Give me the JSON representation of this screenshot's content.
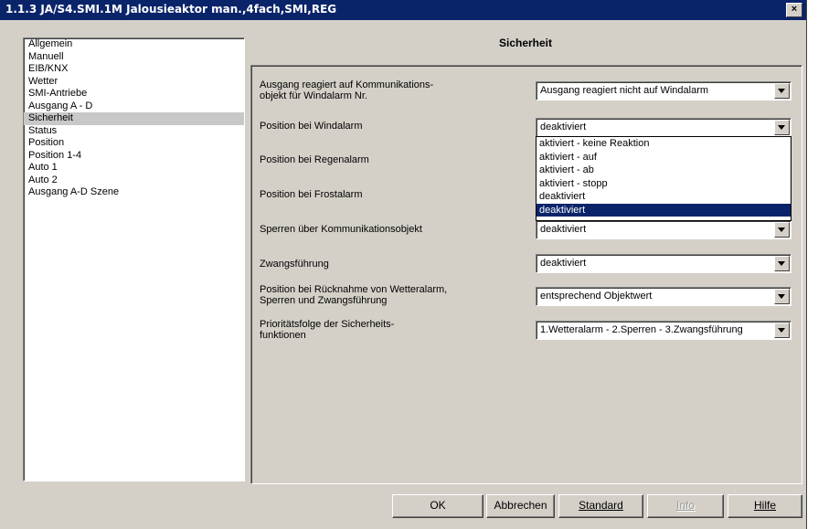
{
  "window": {
    "title": "1.1.3 JA/S4.SMI.1M Jalousieaktor man.,4fach,SMI,REG",
    "close_label": "×"
  },
  "sidebar": {
    "items": [
      {
        "label": "Allgemein"
      },
      {
        "label": "Manuell"
      },
      {
        "label": "EIB/KNX"
      },
      {
        "label": "Wetter"
      },
      {
        "label": "SMI-Antriebe"
      },
      {
        "label": "Ausgang A - D"
      },
      {
        "label": "Sicherheit",
        "selected": true
      },
      {
        "label": "Status"
      },
      {
        "label": "Position"
      },
      {
        "label": "Position 1-4"
      },
      {
        "label": "Auto 1"
      },
      {
        "label": "Auto 2"
      },
      {
        "label": "Ausgang A-D Szene"
      }
    ]
  },
  "section_title": "Sicherheit",
  "params": [
    {
      "label_lines": [
        "Ausgang reagiert auf Kommunikations-",
        "objekt für Windalarm Nr."
      ],
      "value": "Ausgang reagiert nicht auf Windalarm"
    },
    {
      "label_lines": [
        "Position bei Windalarm"
      ],
      "value": "deaktiviert"
    },
    {
      "label_lines": [
        "Position bei Regenalarm"
      ]
    },
    {
      "label_lines": [
        "Position bei Frostalarm"
      ]
    },
    {
      "label_lines": [
        "Sperren über Kommunikationsobjekt"
      ],
      "value": "deaktiviert"
    },
    {
      "label_lines": [
        "Zwangsführung"
      ],
      "value": "deaktiviert"
    },
    {
      "label_lines": [
        "Position bei Rücknahme von Wetteralarm,",
        "Sperren und Zwangsführung"
      ],
      "value": "entsprechend Objektwert"
    },
    {
      "label_lines": [
        "Prioritätsfolge der Sicherheits-",
        "funktionen"
      ],
      "value": "1.Wetteralarm - 2.Sperren - 3.Zwangsführung"
    }
  ],
  "dropdown": {
    "options": [
      "aktiviert - keine Reaktion",
      "aktiviert - auf",
      "aktiviert - ab",
      "aktiviert - stopp",
      "deaktiviert",
      "deaktiviert"
    ],
    "selected_index": 5
  },
  "buttons": {
    "ok": "OK",
    "cancel": "Abbrechen",
    "standard": "Standard",
    "info": "Info",
    "help": "Hilfe"
  }
}
